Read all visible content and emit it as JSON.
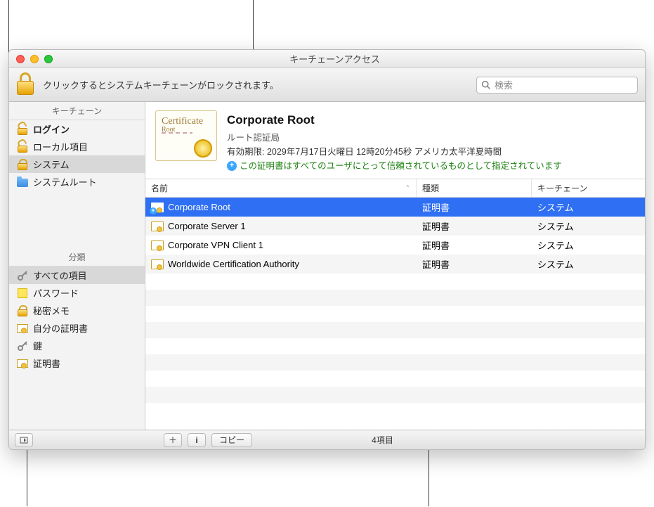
{
  "window": {
    "title": "キーチェーンアクセス"
  },
  "toolbar": {
    "lock_hint": "クリックするとシステムキーチェーンがロックされます。",
    "search_placeholder": "検索"
  },
  "sidebar": {
    "keychains_header": "キーチェーン",
    "keychains": [
      {
        "label": "ログイン",
        "icon": "unlock",
        "bold": true,
        "selected": false
      },
      {
        "label": "ローカル項目",
        "icon": "unlock",
        "bold": false,
        "selected": false
      },
      {
        "label": "システム",
        "icon": "lock",
        "bold": false,
        "selected": true
      },
      {
        "label": "システムルート",
        "icon": "folder",
        "bold": false,
        "selected": false
      }
    ],
    "categories_header": "分類",
    "categories": [
      {
        "label": "すべての項目",
        "icon": "keys",
        "selected": true
      },
      {
        "label": "パスワード",
        "icon": "note",
        "selected": false
      },
      {
        "label": "秘密メモ",
        "icon": "lock",
        "selected": false
      },
      {
        "label": "自分の証明書",
        "icon": "cert",
        "selected": false
      },
      {
        "label": "鍵",
        "icon": "key",
        "selected": false
      },
      {
        "label": "証明書",
        "icon": "cert",
        "selected": false
      }
    ]
  },
  "detail": {
    "name": "Corporate Root",
    "type": "ルート認証局",
    "expiry_label": "有効期限:",
    "expiry_value": "2029年7月17日火曜日 12時20分45秒 アメリカ太平洋夏時間",
    "trust_text": "この証明書はすべてのユーザにとって信頼されているものとして指定されています",
    "ill_text": "Certificate",
    "ill_sub": "Root"
  },
  "table": {
    "columns": {
      "name": "名前",
      "kind": "種類",
      "keychain": "キーチェーン"
    },
    "rows": [
      {
        "name": "Corporate Root",
        "kind": "証明書",
        "keychain": "システム",
        "selected": true,
        "plus": true
      },
      {
        "name": "Corporate Server 1",
        "kind": "証明書",
        "keychain": "システム",
        "selected": false,
        "plus": false
      },
      {
        "name": "Corporate VPN Client 1",
        "kind": "証明書",
        "keychain": "システム",
        "selected": false,
        "plus": false
      },
      {
        "name": "Worldwide Certification Authority",
        "kind": "証明書",
        "keychain": "システム",
        "selected": false,
        "plus": false
      }
    ]
  },
  "statusbar": {
    "copy_label": "コピー",
    "count_text": "4項目"
  }
}
